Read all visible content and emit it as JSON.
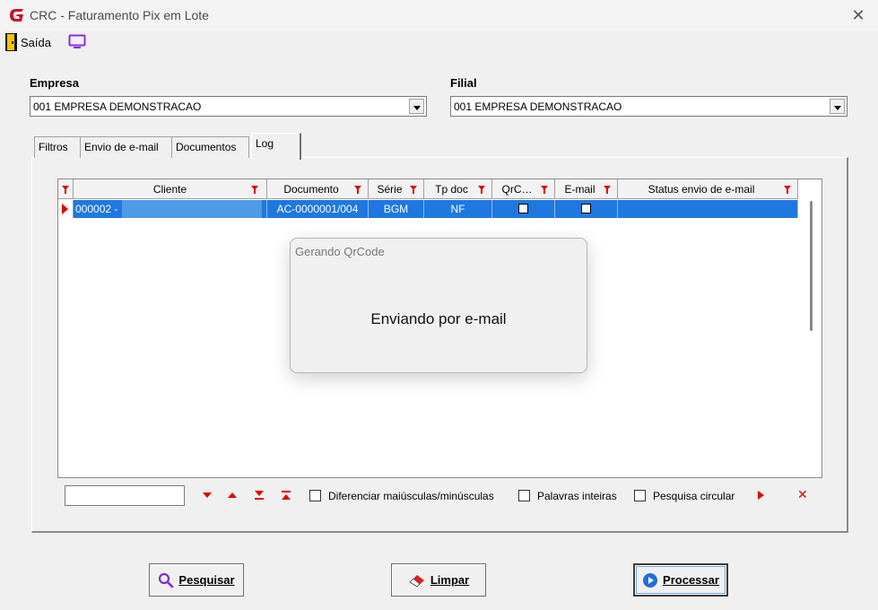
{
  "window": {
    "title": "CRC - Faturamento Pix em Lote",
    "close_glyph": "✕"
  },
  "menu": {
    "exit_label": "Saída"
  },
  "empresa": {
    "label": "Empresa",
    "value": "001 EMPRESA DEMONSTRACAO"
  },
  "filial": {
    "label": "Filial",
    "value": "001 EMPRESA DEMONSTRACAO"
  },
  "tabs": [
    {
      "label": "Filtros"
    },
    {
      "label": "Envio de e-mail"
    },
    {
      "label": "Documentos"
    },
    {
      "label": "Log"
    }
  ],
  "grid": {
    "columns": [
      "Cliente",
      "Documento",
      "Série",
      "Tp doc",
      "QrC…",
      "E-mail",
      "Status envio de e-mail"
    ],
    "rows": [
      {
        "cliente": "000002 -",
        "documento": "AC-0000001/004",
        "serie": "BGM",
        "tp_doc": "NF",
        "qrcode": false,
        "email": false,
        "status": ""
      }
    ]
  },
  "search": {
    "case_label": "Diferenciar maiúsculas/minúsculas",
    "words_label": "Palavras inteiras",
    "circular_label": "Pesquisa circular",
    "close_glyph": "✕"
  },
  "popup": {
    "title": "Gerando QrCode",
    "message": "Enviando por e-mail"
  },
  "buttons": {
    "search": "Pesquisar",
    "clear": "Limpar",
    "process": "Processar"
  },
  "colors": {
    "selection": "#1f78e0",
    "filter_red": "#e00000",
    "accent_purple": "#8a2be2"
  }
}
